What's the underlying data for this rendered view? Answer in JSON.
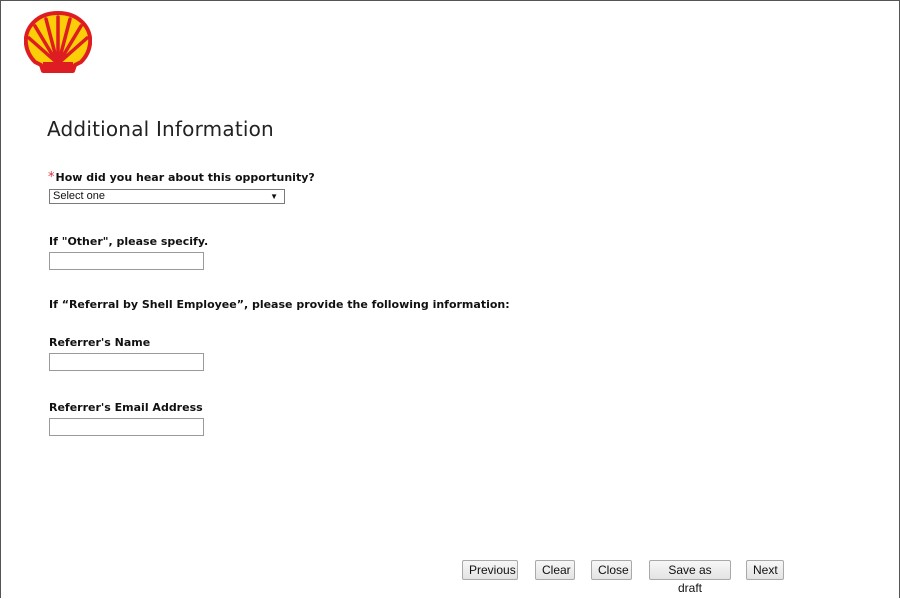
{
  "header": {
    "logo_icon": "shell-pecten-logo",
    "colors": {
      "logo_red": "#DD1D21",
      "logo_yellow": "#FBCE07"
    }
  },
  "page": {
    "title": "Additional Information"
  },
  "form": {
    "hear_about": {
      "required_marker": "*",
      "label": "How did you hear about this opportunity?",
      "selected_value": "Select one",
      "arrow_icon": "dropdown-arrow-icon"
    },
    "other": {
      "label": "If \"Other\", please specify.",
      "value": ""
    },
    "referral_note": "If “Referral by Shell Employee”, please provide the following information:",
    "referrer_name": {
      "label": "Referrer's Name",
      "value": ""
    },
    "referrer_email": {
      "label": "Referrer's Email Address",
      "value": ""
    }
  },
  "buttons": {
    "previous": "Previous",
    "clear": "Clear",
    "close": "Close",
    "save_draft": "Save as draft",
    "next": "Next"
  },
  "colors": {
    "required": "#D9363E"
  }
}
